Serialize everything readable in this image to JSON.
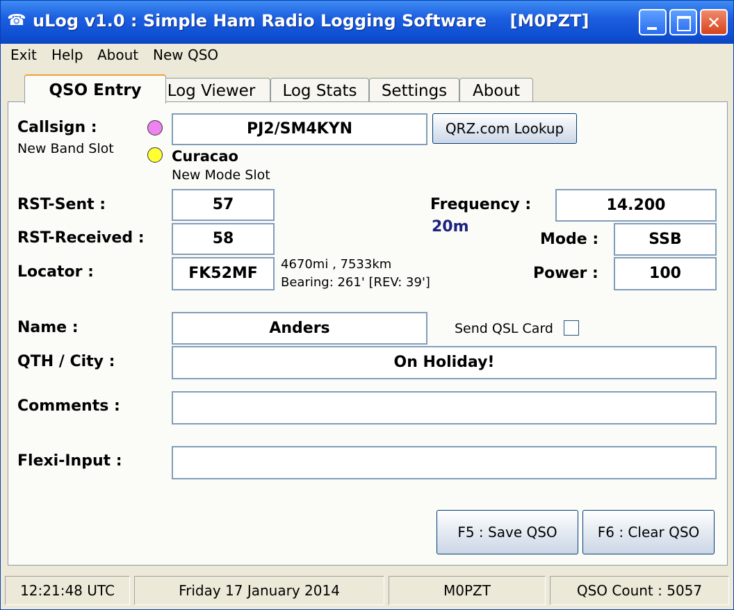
{
  "window": {
    "title": "uLog v1.0 : Simple Ham Radio Logging Software",
    "callsign_tag": "[M0PZT]"
  },
  "menu": {
    "items": [
      "Exit",
      "Help",
      "About",
      "New QSO"
    ]
  },
  "tabs": [
    {
      "label": "QSO Entry"
    },
    {
      "label": "Log Viewer"
    },
    {
      "label": "Log Stats"
    },
    {
      "label": "Settings"
    },
    {
      "label": "About"
    }
  ],
  "form": {
    "callsign_label": "Callsign :",
    "callsign_value": "PJ2/SM4KYN",
    "new_band_slot": "New Band Slot",
    "country": "Curacao",
    "new_mode_slot": "New Mode Slot",
    "qrz_button": "QRZ.com Lookup",
    "rst_sent_label": "RST-Sent :",
    "rst_sent_value": "57",
    "rst_received_label": "RST-Received :",
    "rst_received_value": "58",
    "locator_label": "Locator  :",
    "locator_value": "FK52MF",
    "distance": "4670mi , 7533km",
    "bearing": "Bearing: 261' [REV: 39']",
    "frequency_label": "Frequency :",
    "frequency_value": "14.200",
    "band": "20m",
    "mode_label": "Mode :",
    "mode_value": "SSB",
    "power_label": "Power :",
    "power_value": "100",
    "name_label": "Name :",
    "name_value": "Anders",
    "send_qsl_label": "Send QSL Card",
    "qth_label": "QTH / City :",
    "qth_value": "On Holiday!",
    "comments_label": "Comments  :",
    "comments_value": "",
    "flexi_label": "Flexi-Input :",
    "flexi_value": "",
    "save_button": "F5 : Save QSO",
    "clear_button": "F6 : Clear QSO"
  },
  "status": {
    "time": "12:21:48  UTC",
    "date": "Friday 17 January 2014",
    "operator": "M0PZT",
    "qso_count": "QSO Count : 5057"
  },
  "colors": {
    "band_slot_dot": "#ee82ee",
    "mode_slot_dot": "#ffff33",
    "band_text": "#1a237e",
    "title_bar": "#1c5fe0"
  }
}
